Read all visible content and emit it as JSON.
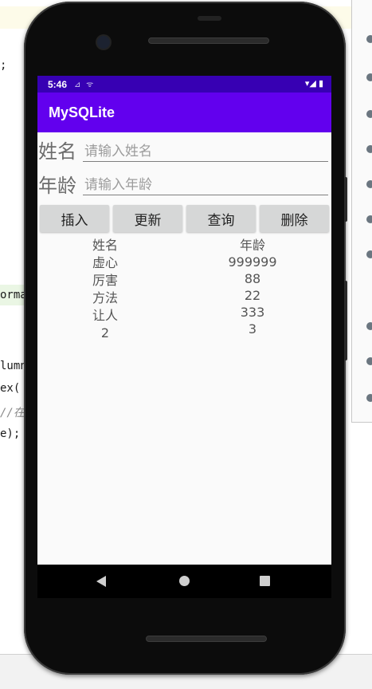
{
  "ide": {
    "code_lines": [
      ";",
      "orma",
      "lumn",
      "ex(",
      "//在",
      "e);"
    ]
  },
  "status_bar": {
    "time": "5:46",
    "left_icons": "⊿ ᯤ",
    "right_icons": "▾◢ ▮"
  },
  "app_bar": {
    "title": "MySQLite"
  },
  "form": {
    "name_label": "姓名",
    "name_placeholder": "请输入姓名",
    "age_label": "年龄",
    "age_placeholder": "请输入年龄"
  },
  "buttons": {
    "insert": "插入",
    "update": "更新",
    "query": "查询",
    "delete": "删除"
  },
  "results": {
    "name_header": "姓名",
    "age_header": "年龄",
    "names": [
      "虚心",
      "厉害",
      "方法",
      "让人",
      "2"
    ],
    "ages": [
      "999999",
      "88",
      "22",
      "333",
      "3"
    ]
  },
  "colors": {
    "status_bar": "#3700b3",
    "app_bar": "#6200ee",
    "button_bg": "#d6d7d7"
  }
}
